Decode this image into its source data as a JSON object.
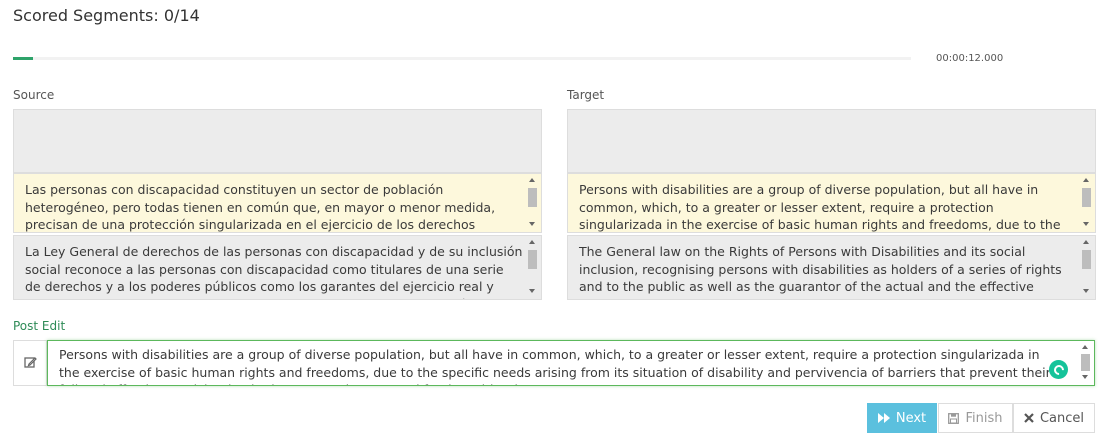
{
  "header": {
    "scored_segments": "Scored Segments: 0/14"
  },
  "progress": {
    "fraction": 0.022,
    "time": "00:00:12.000",
    "color": "#2ea36a"
  },
  "source": {
    "label": "Source",
    "current_segment": "Las personas con discapacidad constituyen un sector de población heterogéneo, pero todas tienen en común que, en mayor o menor medida, precisan de una protección singularizada en el ejercicio de los derechos humanos y libertades básicas, debido a las necesidades específicas derivadas de su situación de discapacidad y de la pervivencia de barreras.",
    "next_segment": "La Ley General de derechos de las personas con discapacidad y de su inclusión social reconoce a las personas con discapacidad como titulares de una serie de derechos y a los poderes públicos como los garantes del ejercicio real y efectivo de esos derechos, de acuerdo con lo previsto en la Convención Internacional de los derechos de las personas con discapacidad."
  },
  "target": {
    "label": "Target",
    "current_segment": "Persons with disabilities are a group of diverse population, but all have in common, which, to a greater or lesser extent, require a protection singularizada in the exercise of basic human rights and freedoms, due to the specific needs arising from its situation of disability and pervivencia of barriers.",
    "next_segment": "The General law on the Rights of Persons with Disabilities and its social inclusion, recognising persons with disabilities as holders of a series of rights and to the public as well as the guarantor of the actual and the effective exercise of those rights, in accordance with the provisions of the International Convention on the rights of persons with disabilities."
  },
  "post_edit": {
    "label": "Post Edit",
    "value": "Persons with disabilities are a group of diverse population, but all have in common, which, to a greater or lesser extent, require a protection singularizada in the exercise of basic human rights and freedoms, due to the specific needs arising from its situation of disability and pervivencia of barriers that prevent their full and effective participation in the community on equal footing with others."
  },
  "buttons": {
    "next": "Next",
    "finish": "Finish",
    "cancel": "Cancel"
  },
  "colors": {
    "accent_green": "#2e8b57",
    "next_button": "#5bc0de",
    "current_highlight": "#fdf8dc",
    "grammar_badge": "#15c39a"
  },
  "icons": {
    "post_edit": "edit-icon",
    "next": "fast-forward-icon",
    "finish": "save-icon",
    "cancel": "close-icon",
    "grammar": "grammarly-icon"
  }
}
